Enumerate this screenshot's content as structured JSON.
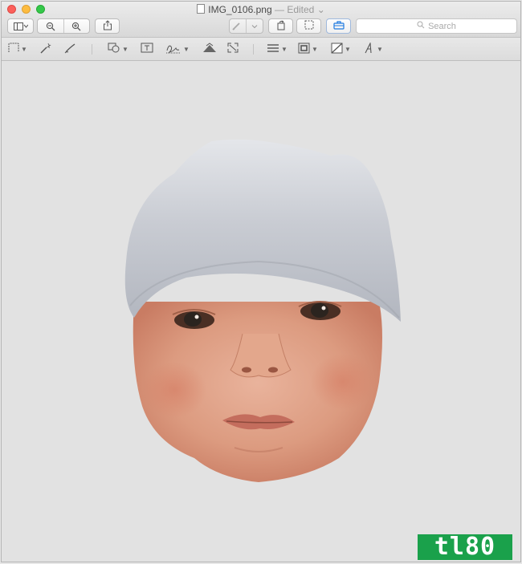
{
  "window": {
    "title": "IMG_0106.png",
    "edited_label": "— Edited",
    "edited_chevron": "⌄"
  },
  "toolbar": {
    "sidebar_button_icon": "sidebar-icon",
    "zoom_out_icon": "zoom-out-icon",
    "zoom_in_icon": "zoom-in-icon",
    "share_icon": "share-icon",
    "pen_icon": "pen-icon",
    "rotate_icon": "rotate-icon",
    "selection_icon": "selection-icon",
    "toolbox_icon": "toolbox-icon",
    "search_placeholder": "Search"
  },
  "markup_toolbar": {
    "tools": [
      "selection-tools",
      "instant-alpha",
      "sketch",
      "shapes",
      "text",
      "sign",
      "adjust-color",
      "adjust-size",
      "shape-style",
      "border-color",
      "fill-color",
      "text-style"
    ]
  },
  "watermark": {
    "text": "tl80"
  },
  "colors": {
    "accent_active": "#1f7ae0",
    "watermark_bg": "#1aa14b",
    "canvas_bg": "#e2e2e2"
  }
}
